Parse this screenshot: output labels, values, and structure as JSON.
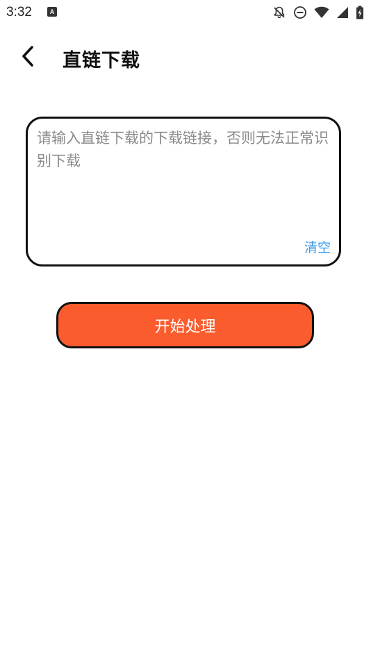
{
  "status_bar": {
    "time": "3:32",
    "a_badge": "A",
    "icons": [
      "notifications-off-icon",
      "do-not-disturb-icon",
      "wifi-icon",
      "cell-signal-icon",
      "battery-charging-icon"
    ]
  },
  "header": {
    "back_icon": "chevron-left-icon",
    "title": "直链下载"
  },
  "url_input": {
    "placeholder": "请输入直链下载的下载链接，否则无法正常识别下载",
    "value": "",
    "clear_label": "清空"
  },
  "actions": {
    "start_label": "开始处理"
  },
  "colors": {
    "accent": "#fa5c2d",
    "link": "#3b9be8",
    "border": "#111111",
    "placeholder": "#8a8a8a"
  }
}
